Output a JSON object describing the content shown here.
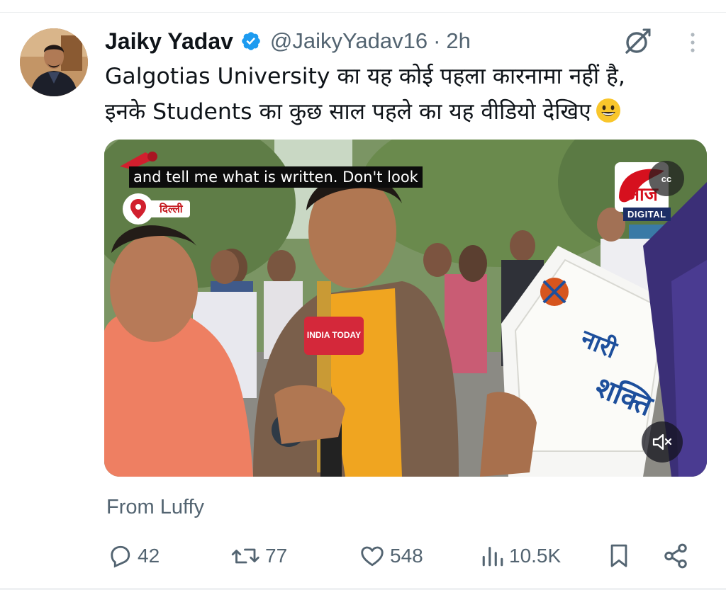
{
  "tweet": {
    "author_name": "Jaiky Yadav",
    "handle": "@JaikyYadav16",
    "separator": "·",
    "time": "2h",
    "text_line1": "Galgotias University का यह कोई पहला कारनामा नहीं है,",
    "text_line2": "इनके Students का कुछ साल पहले का यह वीडियो देखिए",
    "emoji": "grinning-face-emoji",
    "source": "From Luffy"
  },
  "media": {
    "subtitle": "and tell me what is written. Don't look",
    "location_label": "दिल्ली",
    "channel_badge": "DIGITAL",
    "cc_label": "cc",
    "mic_flag": "INDIA TODAY"
  },
  "actions": {
    "replies": "42",
    "reposts": "77",
    "likes": "548",
    "views": "10.5K"
  },
  "icons": {
    "verified": "verified-badge-icon",
    "grok": "grok-icon",
    "more": "more-vertical-icon",
    "reply": "reply-icon",
    "repost": "repost-icon",
    "like": "heart-icon",
    "views": "views-icon",
    "bookmark": "bookmark-icon",
    "share": "share-icon",
    "mute": "mute-icon",
    "cc": "closed-captions-icon"
  },
  "colors": {
    "text_primary": "#0f1419",
    "text_secondary": "#536471",
    "verified_blue": "#1d9bf0"
  }
}
